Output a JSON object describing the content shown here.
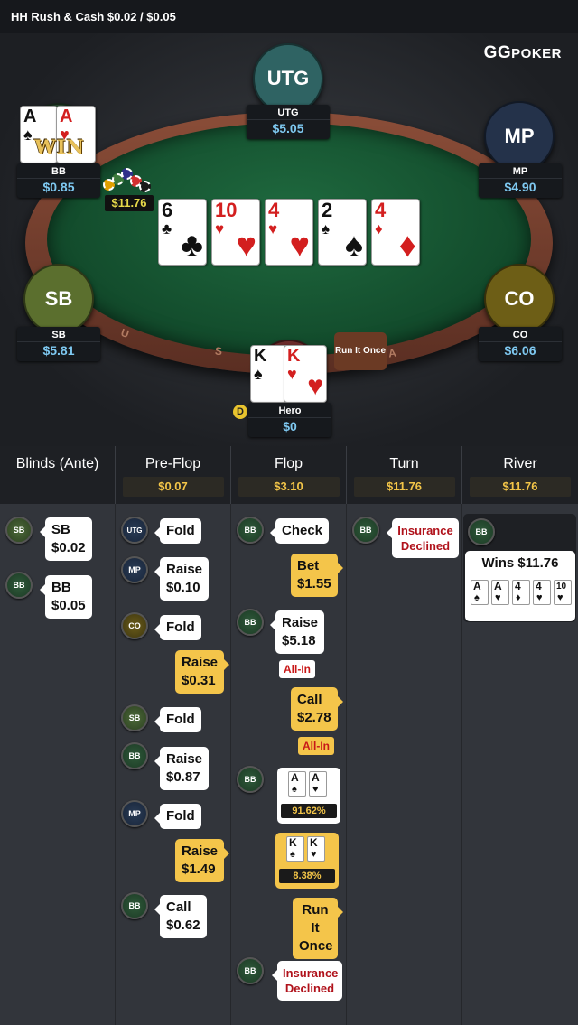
{
  "title": "HH  Rush & Cash $0.02 / $0.05",
  "logo": {
    "brand": "GG",
    "suffix": "POKER"
  },
  "seats": {
    "utg": {
      "label": "UTG",
      "name": "UTG",
      "stack": "$5.05",
      "color": "#2f6363"
    },
    "mp": {
      "label": "MP",
      "name": "MP",
      "stack": "$4.90",
      "color": "#24324a"
    },
    "co": {
      "label": "CO",
      "name": "CO",
      "stack": "$6.06",
      "color": "#6d5e16"
    },
    "sb": {
      "label": "SB",
      "name": "SB",
      "stack": "$5.81",
      "color": "#5b6f2e"
    },
    "bb": {
      "name": "BB",
      "stack": "$0.85",
      "win_text": "WIN"
    },
    "hero": {
      "name": "Hero",
      "stack": "$0"
    }
  },
  "bb_cards": [
    {
      "rank": "A",
      "suit": "♠"
    },
    {
      "rank": "A",
      "suit": "♥"
    }
  ],
  "hero_cards": [
    {
      "rank": "K",
      "suit": "♠"
    },
    {
      "rank": "K",
      "suit": "♥"
    }
  ],
  "board": [
    {
      "rank": "6",
      "suit": "♣"
    },
    {
      "rank": "10",
      "suit": "♥"
    },
    {
      "rank": "4",
      "suit": "♥"
    },
    {
      "rank": "2",
      "suit": "♠"
    },
    {
      "rank": "4",
      "suit": "♦"
    }
  ],
  "pot": "$11.76",
  "dealer_button": "D",
  "run_it_once": "Run It Once",
  "rail_letters": [
    "U",
    "S",
    "A"
  ],
  "columns": [
    {
      "label": "Blinds (Ante)",
      "amount": ""
    },
    {
      "label": "Pre-Flop",
      "amount": "$0.07"
    },
    {
      "label": "Flop",
      "amount": "$3.10"
    },
    {
      "label": "Turn",
      "amount": "$11.76"
    },
    {
      "label": "River",
      "amount": "$11.76"
    }
  ],
  "blinds": [
    {
      "pos": "SB",
      "action": "SB",
      "amount": "$0.02"
    },
    {
      "pos": "BB",
      "action": "BB",
      "amount": "$0.05"
    }
  ],
  "preflop": [
    {
      "pos": "UTG",
      "action": "Fold"
    },
    {
      "pos": "MP",
      "action": "Raise",
      "amount": "$0.10"
    },
    {
      "pos": "CO",
      "action": "Fold"
    },
    {
      "pos": "Hero",
      "action": "Raise",
      "amount": "$0.31"
    },
    {
      "pos": "SB",
      "action": "Fold"
    },
    {
      "pos": "BB",
      "action": "Raise",
      "amount": "$0.87"
    },
    {
      "pos": "MP",
      "action": "Fold"
    },
    {
      "pos": "Hero",
      "action": "Raise",
      "amount": "$1.49"
    },
    {
      "pos": "BB",
      "action": "Call",
      "amount": "$0.62"
    }
  ],
  "flop": [
    {
      "pos": "BB",
      "action": "Check"
    },
    {
      "pos": "Hero",
      "action": "Bet",
      "amount": "$1.55"
    },
    {
      "pos": "BB",
      "action": "Raise",
      "amount": "$5.18",
      "tag": "All-In"
    },
    {
      "pos": "Hero",
      "action": "Call",
      "amount": "$2.78",
      "tag": "All-In"
    },
    {
      "pos": "BB",
      "equity": "91.62%"
    },
    {
      "pos": "Hero",
      "equity": "8.38%"
    },
    {
      "pos": "Hero",
      "action": "Run It Once"
    },
    {
      "pos": "BB",
      "action": "Insurance Declined"
    }
  ],
  "turn": [
    {
      "pos": "BB",
      "action": "Insurance Declined"
    }
  ],
  "river": {
    "pos": "BB",
    "result": "Wins $11.76",
    "cards": [
      {
        "rank": "A",
        "suit": "♠"
      },
      {
        "rank": "A",
        "suit": "♥"
      },
      {
        "rank": "4",
        "suit": "♦"
      },
      {
        "rank": "4",
        "suit": "♥"
      },
      {
        "rank": "10",
        "suit": "♥"
      }
    ]
  }
}
